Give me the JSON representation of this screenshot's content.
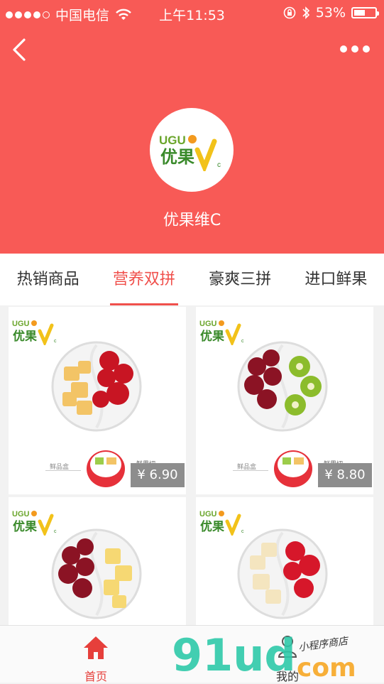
{
  "status_bar": {
    "carrier": "中国电信",
    "time": "上午11:53",
    "battery": "53%",
    "battery_level": 0.53
  },
  "store": {
    "name": "优果维C",
    "logo_text": "UGU 优果 V c"
  },
  "tabs": [
    {
      "label": "热销商品",
      "active": false
    },
    {
      "label": "营养双拼",
      "active": true
    },
    {
      "label": "豪爽三拼",
      "active": false
    },
    {
      "label": "进口鲜果",
      "active": false
    }
  ],
  "products": [
    {
      "price": "¥ 6.90",
      "cup_label_left": "鲜品盒",
      "cup_label_right": "鲜果切"
    },
    {
      "price": "¥ 8.80",
      "cup_label_left": "鲜品盒",
      "cup_label_right": "鲜果切"
    },
    {
      "price": ""
    },
    {
      "price": ""
    }
  ],
  "bottom_nav": {
    "home": "首页",
    "mine": "我的"
  },
  "watermark": {
    "logo": "91ud",
    "domain": "com",
    "tagline": "小程序商店"
  },
  "colors": {
    "header_bg": "#f85a56",
    "accent": "#f0504c"
  }
}
